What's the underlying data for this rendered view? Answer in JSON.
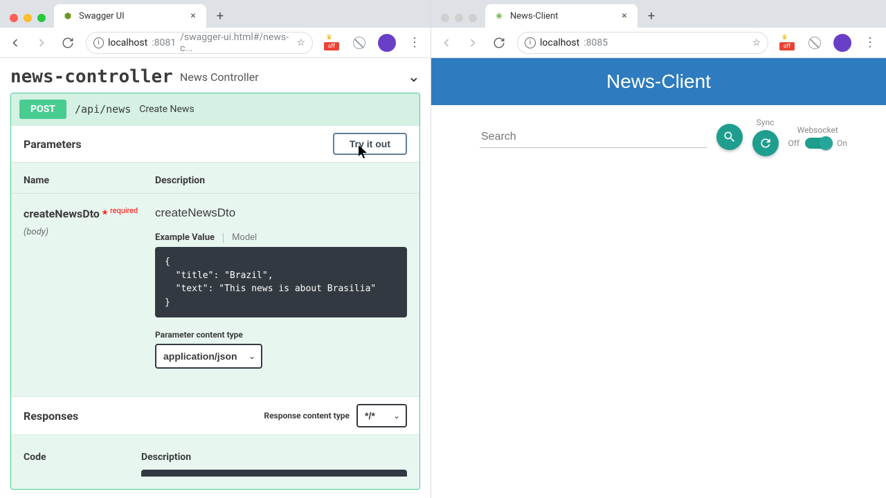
{
  "left": {
    "tab_title": "Swagger UI",
    "url_host": "localhost",
    "url_port": ":8081",
    "url_path": "/swagger-ui.html#/news-c...",
    "controller_name": "news-controller",
    "controller_desc": "News Controller",
    "op_method": "POST",
    "op_path": "/api/news",
    "op_summary": "Create News",
    "parameters_heading": "Parameters",
    "try_label": "Try it out",
    "col_name": "Name",
    "col_desc": "Description",
    "param_name": "createNewsDto",
    "param_required": "required",
    "param_in": "(body)",
    "param_desc": "createNewsDto",
    "tab_example": "Example Value",
    "tab_model": "Model",
    "example_json": "{\n  \"title\": \"Brazil\",\n  \"text\": \"This news is about Brasilia\"\n}",
    "pct_label": "Parameter content type",
    "pct_value": "application/json",
    "responses_heading": "Responses",
    "rct_label": "Response content type",
    "rct_value": "*/*",
    "code_col_name": "Code",
    "code_col_desc": "Description"
  },
  "right": {
    "tab_title": "News-Client",
    "url_host": "localhost",
    "url_port": ":8085",
    "header": "News-Client",
    "search_placeholder": "Search",
    "sync_label": "Sync",
    "ws_label": "Websocket",
    "off_label": "Off",
    "on_label": "On"
  },
  "ext_badge": "off"
}
